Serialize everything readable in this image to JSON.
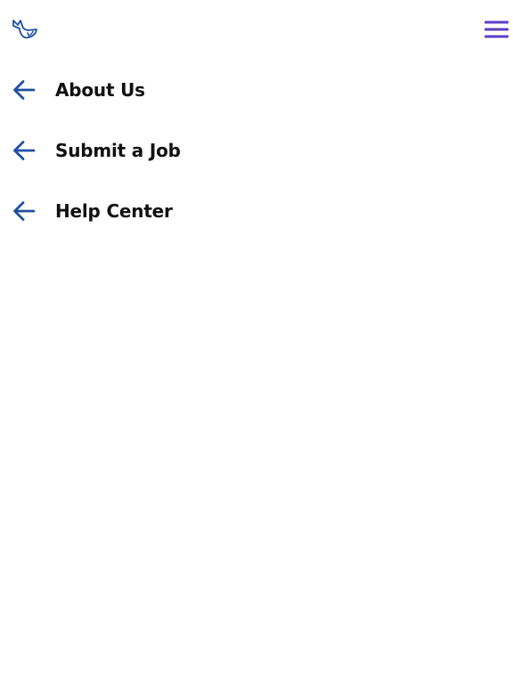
{
  "header": {
    "logo_icon": "whale-logo-icon",
    "menu_icon": "hamburger-menu-icon"
  },
  "nav": {
    "items": [
      {
        "label": "About Us",
        "icon": "arrow-left-icon"
      },
      {
        "label": "Submit a Job",
        "icon": "arrow-left-icon"
      },
      {
        "label": "Help Center",
        "icon": "arrow-left-icon"
      }
    ]
  },
  "colors": {
    "arrow": "#1e4fa3",
    "menu": "#5b3fc4",
    "logo": "#1e4fa3",
    "text": "#111111",
    "background": "#ffffff"
  }
}
